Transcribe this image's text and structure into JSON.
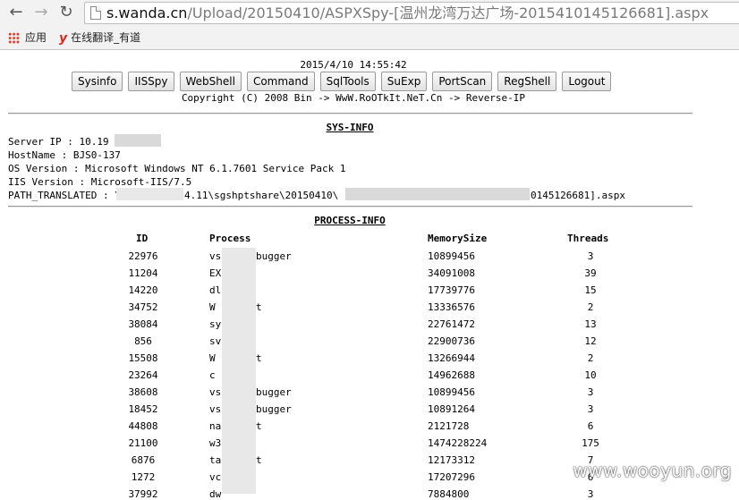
{
  "browser": {
    "url_host": "s.wanda.cn",
    "url_path": "/Upload/20150410/ASPXSpy-[温州龙湾万达广场-2015410145126681].aspx",
    "bookmarks": [
      {
        "label": "应用",
        "icon": "apps-grid-icon"
      },
      {
        "label": "在线翻译_有道",
        "icon": "youdao-logo-icon"
      }
    ]
  },
  "header": {
    "date": "2015/4/10 14:55:42",
    "buttons": [
      "Sysinfo",
      "IISSpy",
      "WebShell",
      "Command",
      "SqlTools",
      "SuExp",
      "PortScan",
      "RegShell",
      "Logout"
    ],
    "copyright": "Copyright (C) 2008 Bin -> WwW.RoOTkIt.NeT.Cn -> Reverse-IP"
  },
  "sysinfo": {
    "title": "SYS-INFO",
    "server_ip": "Server IP : 10.19",
    "hostname": "HostName : BJS0-137",
    "os_version": "OS Version : Microsoft Windows NT 6.1.7601 Service Pack 1",
    "iis_version": "IIS Version : Microsoft-IIS/7.5",
    "path_a": "PATH_TRANSLATED : \\",
    "path_b": "4.11\\sgshptshare\\20150410\\",
    "path_c": "0145126681].aspx"
  },
  "process": {
    "title": "PROCESS-INFO",
    "headers": {
      "id": "ID",
      "process": "Process",
      "memory": "MemorySize",
      "threads": "Threads"
    },
    "rows": [
      {
        "id": "22976",
        "p1": "vs",
        "p2": "bugger",
        "mem": "10899456",
        "threads": "3"
      },
      {
        "id": "11204",
        "p1": "EX",
        "p2": "",
        "mem": "34091008",
        "threads": "39"
      },
      {
        "id": "14220",
        "p1": "dl",
        "p2": "",
        "mem": "17739776",
        "threads": "15"
      },
      {
        "id": "34752",
        "p1": "W",
        "p2": "t",
        "mem": "13336576",
        "threads": "2"
      },
      {
        "id": "38084",
        "p1": "sy",
        "p2": "",
        "mem": "22761472",
        "threads": "13"
      },
      {
        "id": "856",
        "p1": "sv",
        "p2": "",
        "mem": "22900736",
        "threads": "12"
      },
      {
        "id": "15508",
        "p1": "W",
        "p2": "t",
        "mem": "13266944",
        "threads": "2"
      },
      {
        "id": "23264",
        "p1": "c",
        "p2": "",
        "mem": "14962688",
        "threads": "10"
      },
      {
        "id": "38608",
        "p1": "vs",
        "p2": "bugger",
        "mem": "10899456",
        "threads": "3"
      },
      {
        "id": "18452",
        "p1": "vs",
        "p2": "bugger",
        "mem": "10891264",
        "threads": "3"
      },
      {
        "id": "44808",
        "p1": "na",
        "p2": "t",
        "mem": "2121728",
        "threads": "6"
      },
      {
        "id": "21100",
        "p1": "w3",
        "p2": "",
        "mem": "1474228224",
        "threads": "175"
      },
      {
        "id": "6876",
        "p1": "ta",
        "p2": "t",
        "mem": "12173312",
        "threads": "7"
      },
      {
        "id": "1272",
        "p1": "vc",
        "p2": "",
        "mem": "17207296",
        "threads": "6"
      },
      {
        "id": "37992",
        "p1": "dw",
        "p2": "",
        "mem": "7884800",
        "threads": "3"
      }
    ]
  },
  "watermark": "www.wooyun.org"
}
